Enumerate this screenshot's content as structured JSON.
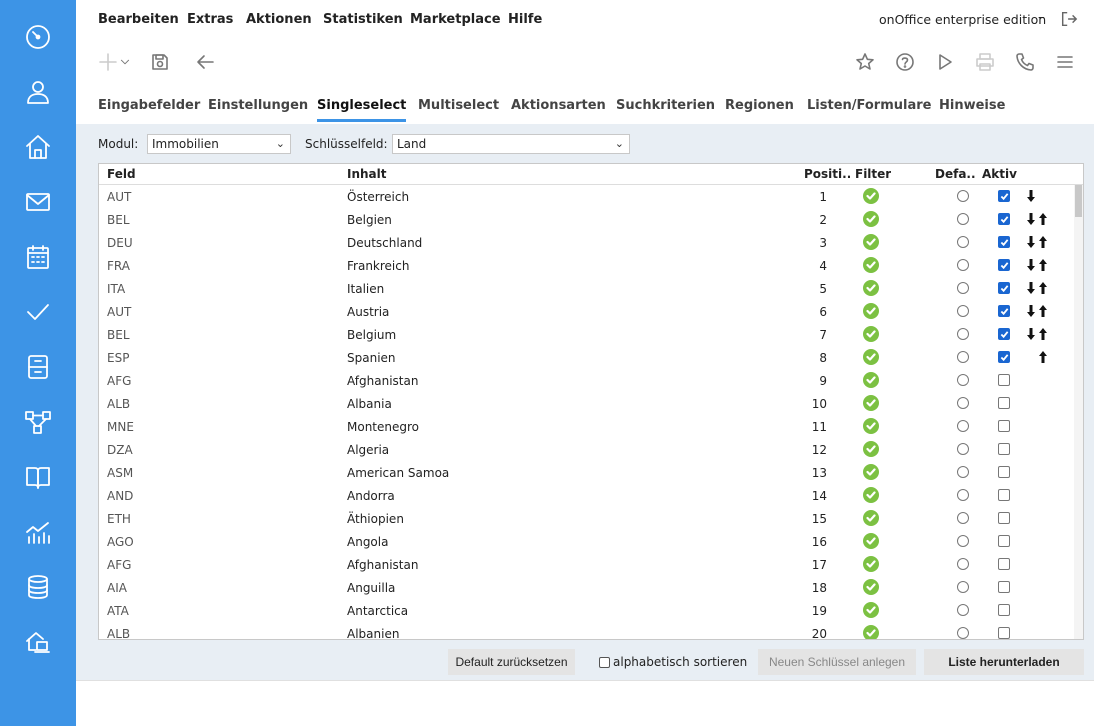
{
  "sidebar": {
    "items": [
      {
        "name": "dashboard",
        "icon": "dashboard-gauge-icon"
      },
      {
        "name": "contacts",
        "icon": "user-icon"
      },
      {
        "name": "estates",
        "icon": "home-icon"
      },
      {
        "name": "email",
        "icon": "envelope-icon"
      },
      {
        "name": "calendar",
        "icon": "calendar-icon"
      },
      {
        "name": "tasks",
        "icon": "checkmark-icon"
      },
      {
        "name": "files",
        "icon": "filing-cabinet-icon"
      },
      {
        "name": "workflow",
        "icon": "workflow-icon"
      },
      {
        "name": "knowledge",
        "icon": "book-icon"
      },
      {
        "name": "statistics",
        "icon": "chart-icon"
      },
      {
        "name": "database",
        "icon": "database-icon"
      },
      {
        "name": "portal",
        "icon": "house-laptop-icon"
      }
    ]
  },
  "menu": {
    "items": [
      "Bearbeiten",
      "Extras",
      "Aktionen",
      "Statistiken",
      "Marketplace",
      "Hilfe"
    ],
    "edition": "onOffice enterprise edition",
    "edition_dash": "–"
  },
  "tabs": {
    "items": [
      "Eingabefelder",
      "Einstellungen",
      "Singleselect",
      "Multiselect",
      "Aktionsarten",
      "Suchkriterien",
      "Regionen",
      "Listen/Formulare",
      "Hinweise"
    ],
    "active": "Singleselect"
  },
  "filters": {
    "modul_label": "Modul:",
    "modul_value": "Immobilien",
    "key_label": "Schlüsselfeld:",
    "key_value": "Land"
  },
  "table": {
    "headers": {
      "feld": "Feld",
      "inhalt": "Inhalt",
      "position": "Positi...",
      "filter": "Filter",
      "default": "Defa...",
      "aktiv": "Aktiv"
    },
    "rows": [
      {
        "code": "AUT",
        "name": "Österreich",
        "pos": "1",
        "filter": true,
        "aktiv": true,
        "down": true,
        "up": false
      },
      {
        "code": "BEL",
        "name": "Belgien",
        "pos": "2",
        "filter": true,
        "aktiv": true,
        "down": true,
        "up": true
      },
      {
        "code": "DEU",
        "name": "Deutschland",
        "pos": "3",
        "filter": true,
        "aktiv": true,
        "down": true,
        "up": true
      },
      {
        "code": "FRA",
        "name": "Frankreich",
        "pos": "4",
        "filter": true,
        "aktiv": true,
        "down": true,
        "up": true
      },
      {
        "code": "ITA",
        "name": "Italien",
        "pos": "5",
        "filter": true,
        "aktiv": true,
        "down": true,
        "up": true
      },
      {
        "code": "AUT",
        "name": "Austria",
        "pos": "6",
        "filter": true,
        "aktiv": true,
        "down": true,
        "up": true
      },
      {
        "code": "BEL",
        "name": "Belgium",
        "pos": "7",
        "filter": true,
        "aktiv": true,
        "down": true,
        "up": true
      },
      {
        "code": "ESP",
        "name": "Spanien",
        "pos": "8",
        "filter": true,
        "aktiv": true,
        "down": false,
        "up": true
      },
      {
        "code": "AFG",
        "name": "Afghanistan",
        "pos": "9",
        "filter": true,
        "aktiv": false,
        "down": false,
        "up": false
      },
      {
        "code": "ALB",
        "name": "Albania",
        "pos": "10",
        "filter": true,
        "aktiv": false,
        "down": false,
        "up": false
      },
      {
        "code": "MNE",
        "name": "Montenegro",
        "pos": "11",
        "filter": true,
        "aktiv": false,
        "down": false,
        "up": false
      },
      {
        "code": "DZA",
        "name": "Algeria",
        "pos": "12",
        "filter": true,
        "aktiv": false,
        "down": false,
        "up": false
      },
      {
        "code": "ASM",
        "name": "American Samoa",
        "pos": "13",
        "filter": true,
        "aktiv": false,
        "down": false,
        "up": false
      },
      {
        "code": "AND",
        "name": "Andorra",
        "pos": "14",
        "filter": true,
        "aktiv": false,
        "down": false,
        "up": false
      },
      {
        "code": "ETH",
        "name": "Äthiopien",
        "pos": "15",
        "filter": true,
        "aktiv": false,
        "down": false,
        "up": false
      },
      {
        "code": "AGO",
        "name": "Angola",
        "pos": "16",
        "filter": true,
        "aktiv": false,
        "down": false,
        "up": false
      },
      {
        "code": "AFG",
        "name": "Afghanistan",
        "pos": "17",
        "filter": true,
        "aktiv": false,
        "down": false,
        "up": false
      },
      {
        "code": "AIA",
        "name": "Anguilla",
        "pos": "18",
        "filter": true,
        "aktiv": false,
        "down": false,
        "up": false
      },
      {
        "code": "ATA",
        "name": "Antarctica",
        "pos": "19",
        "filter": true,
        "aktiv": false,
        "down": false,
        "up": false
      },
      {
        "code": "ALB",
        "name": "Albanien",
        "pos": "20",
        "filter": true,
        "aktiv": false,
        "down": false,
        "up": false
      }
    ]
  },
  "buttons": {
    "reset_default": "Default zurücksetzen",
    "alpha_sort": "alphabetisch sortieren",
    "new_key": "Neuen Schlüssel anlegen",
    "download_list": "Liste herunterladen"
  },
  "colors": {
    "sidebar": "#3d94e6",
    "tab_underline": "#3d94e6",
    "filter_ok": "#7cc142",
    "checkbox_on": "#1a66d1",
    "content_bg": "#e8eef4"
  }
}
